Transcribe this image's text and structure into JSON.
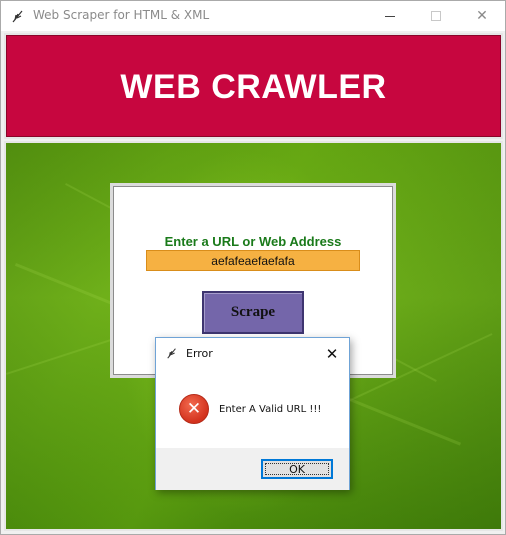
{
  "window": {
    "title": "Web Scraper for HTML & XML",
    "minimize_glyph": "—",
    "maximize_glyph": "☐",
    "close_glyph": "✕",
    "app_icon": "feather-icon"
  },
  "banner": {
    "title": "WEB CRAWLER",
    "color": "#c7063f"
  },
  "form": {
    "url_label": "Enter a URL or Web Address",
    "url_value": "aefafeaefaefafa",
    "scrape_label": "Scrape",
    "label_color": "#1a7a1a",
    "input_color": "#f6b142",
    "button_color": "#7466aa"
  },
  "dialog": {
    "title": "Error",
    "close_glyph": "✕",
    "error_icon": "error-x-icon",
    "error_glyph": "✕",
    "message": "Enter A Valid URL !!!",
    "ok_label": "OK"
  }
}
